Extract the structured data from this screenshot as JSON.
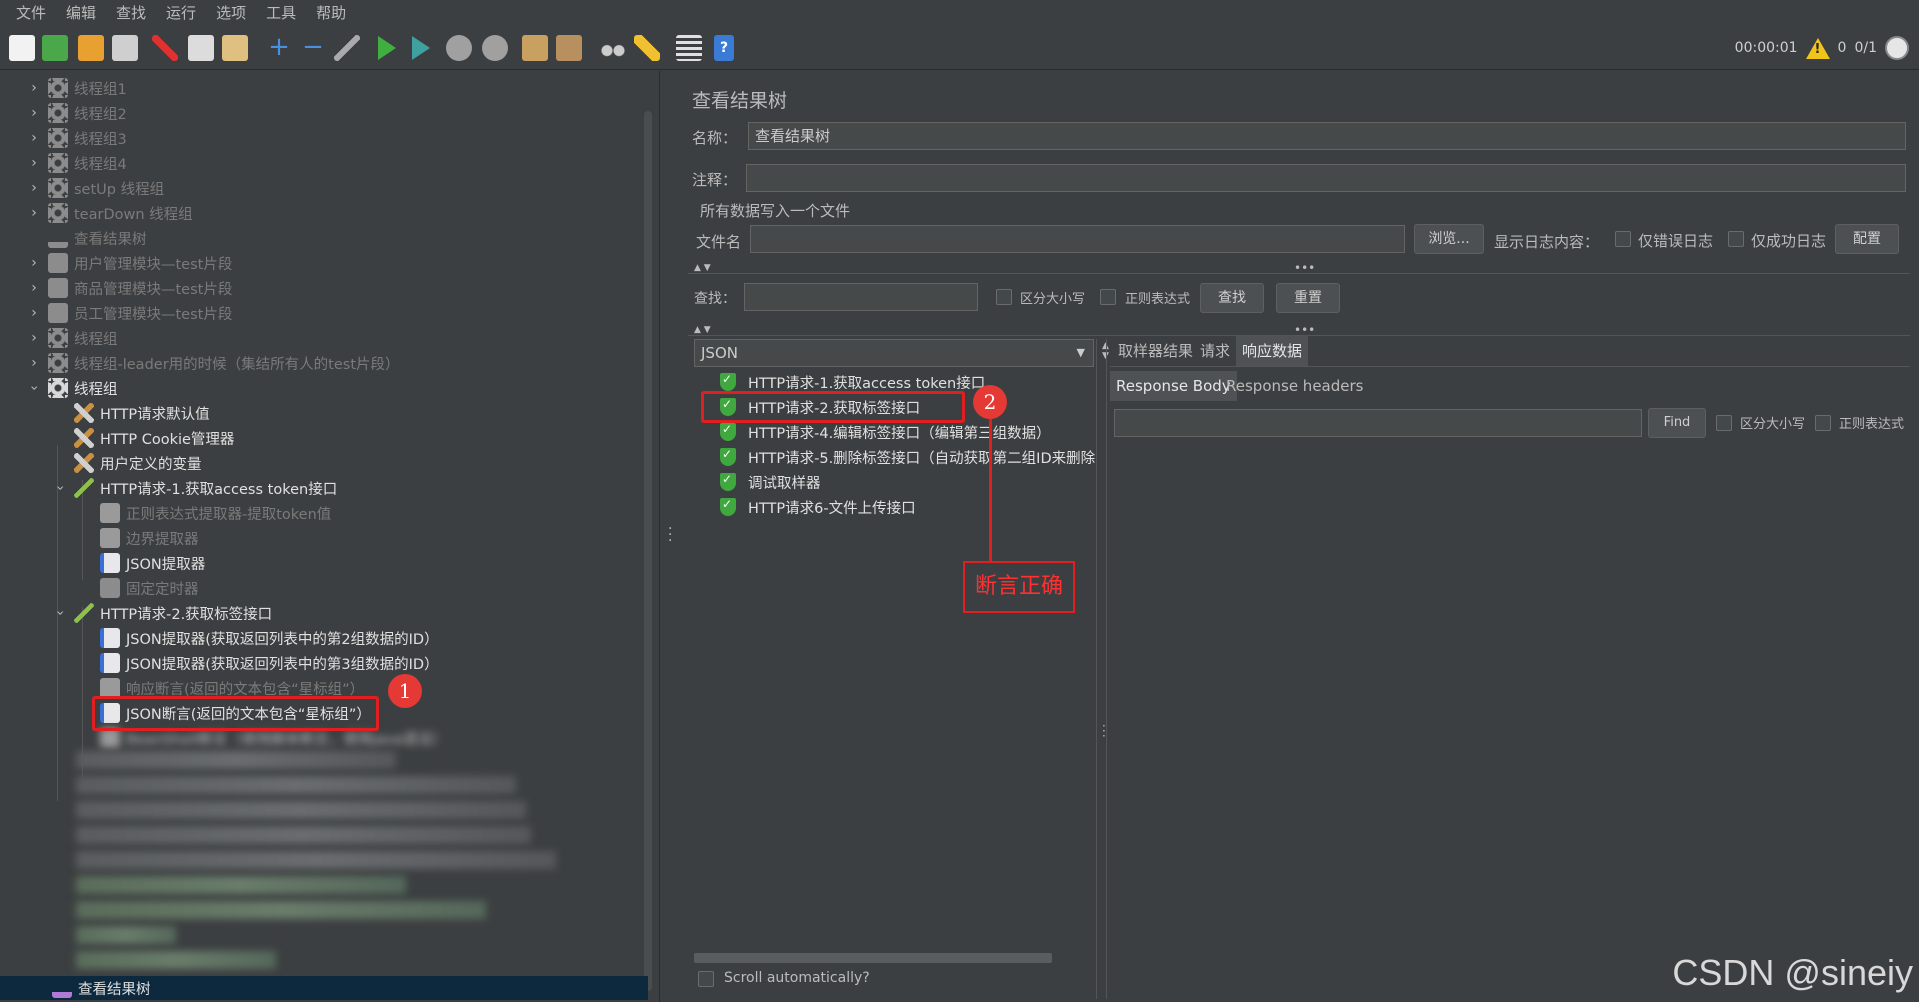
{
  "menu": [
    "文件",
    "编辑",
    "查找",
    "运行",
    "选项",
    "工具",
    "帮助"
  ],
  "toolbar": {
    "elapsed": "00:00:01",
    "warnings": "0",
    "threads": "0/1"
  },
  "tree": {
    "items": [
      {
        "label": "线程组1"
      },
      {
        "label": "线程组2"
      },
      {
        "label": "线程组3"
      },
      {
        "label": "线程组4"
      },
      {
        "label": "setUp 线程组"
      },
      {
        "label": "tearDown 线程组"
      },
      {
        "label": "查看结果树"
      },
      {
        "label": "用户管理模块—test片段"
      },
      {
        "label": "商品管理模块—test片段"
      },
      {
        "label": "员工管理模块—test片段"
      },
      {
        "label": "线程组"
      },
      {
        "label": "线程组-leader用的时候（集结所有人的test片段）"
      },
      {
        "label": "线程组"
      },
      {
        "label": "HTTP请求默认值"
      },
      {
        "label": "HTTP Cookie管理器"
      },
      {
        "label": "用户定义的变量"
      },
      {
        "label": "HTTP请求-1.获取access token接口"
      },
      {
        "label": "正则表达式提取器-提取token值"
      },
      {
        "label": "边界提取器"
      },
      {
        "label": "JSON提取器"
      },
      {
        "label": "固定定时器"
      },
      {
        "label": "HTTP请求-2.获取标签接口"
      },
      {
        "label": "JSON提取器(获取返回列表中的第2组数据的ID）"
      },
      {
        "label": "JSON提取器(获取返回列表中的第3组数据的ID）"
      },
      {
        "label": "响应断言(返回的文本包含“星标组”）"
      },
      {
        "label": "JSON断言(返回的文本包含“星标组”）"
      },
      {
        "label": "BeanShell断言（使用脚本断言，使用java语法）"
      },
      {
        "label": "查看结果树"
      }
    ]
  },
  "panel": {
    "title": "查看结果树",
    "name_label": "名称：",
    "name_value": "查看结果树",
    "comment_label": "注释：",
    "file_section": "所有数据写入一个文件",
    "filename_label": "文件名",
    "browse_button": "浏览...",
    "log_display_label": "显示日志内容：",
    "errors_only": "仅错误日志",
    "success_only": "仅成功日志",
    "configure_button": "配置",
    "search_label": "查找：",
    "case_sensitive": "区分大小写",
    "regex": "正则表达式",
    "find_button": "查找",
    "reset_button": "重置",
    "renderer": "JSON",
    "scroll_auto": "Scroll automatically?"
  },
  "results": [
    {
      "label": "HTTP请求-1.获取access token接口"
    },
    {
      "label": "HTTP请求-2.获取标签接口"
    },
    {
      "label": "HTTP请求-4.编辑标签接口（编辑第三组数据）"
    },
    {
      "label": "HTTP请求-5.删除标签接口（自动获取第二组ID来删除"
    },
    {
      "label": "调试取样器"
    },
    {
      "label": "HTTP请求6-文件上传接口"
    }
  ],
  "detail": {
    "tabs": [
      "取样器结果",
      "请求",
      "响应数据"
    ],
    "subtabs": [
      "Response Body",
      "Response headers"
    ],
    "find_button": "Find",
    "case_sensitive": "区分大小写",
    "regex": "正则表达式"
  },
  "annotations": {
    "marker1": "1",
    "marker2": "2",
    "assert_label": "断言正确"
  },
  "watermark": "CSDN @sineiy"
}
